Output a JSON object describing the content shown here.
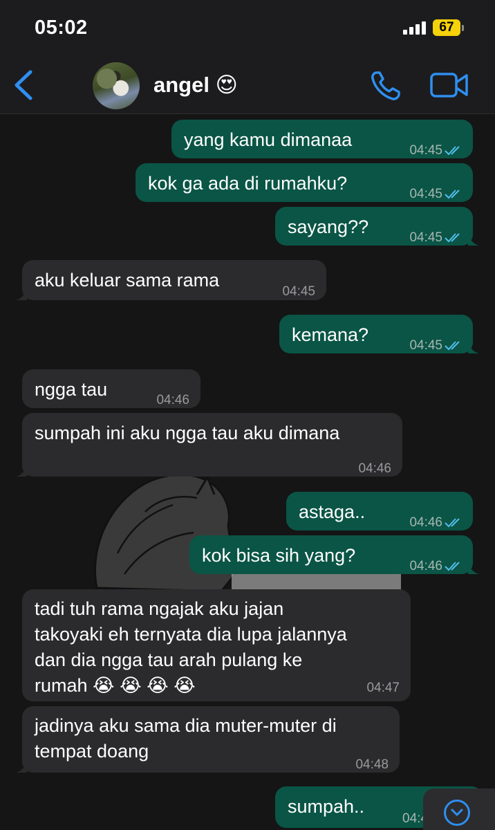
{
  "status_bar": {
    "time": "05:02",
    "battery": "67"
  },
  "header": {
    "contact_name": "angel 😍"
  },
  "messages": [
    {
      "text": "yang kamu dimanaa",
      "time": "04:45"
    },
    {
      "text": "kok ga ada di rumahku?",
      "time": "04:45"
    },
    {
      "text": "sayang??",
      "time": "04:45"
    },
    {
      "text": "aku keluar sama rama",
      "time": "04:45"
    },
    {
      "text": "kemana?",
      "time": "04:45"
    },
    {
      "text": "ngga tau",
      "time": "04:46"
    },
    {
      "text": "sumpah ini aku ngga tau aku dimana",
      "time": "04:46"
    },
    {
      "text": "astaga..",
      "time": "04:46"
    },
    {
      "text": "kok bisa sih yang?",
      "time": "04:46"
    },
    {
      "text": "tadi tuh rama ngajak aku jajan\ntakoyaki eh ternyata dia lupa jalannya\ndan dia ngga tau arah pulang ke\nrumah 😭 😭 😭 😭",
      "time": "04:47"
    },
    {
      "text": "jadinya aku sama dia muter-muter di\ntempat doang",
      "time": "04:48"
    },
    {
      "text": "sumpah..",
      "time": "04:4"
    }
  ],
  "colors": {
    "outgoing": "#0a5546",
    "incoming": "#2b2b2d",
    "accent": "#2f8ff0",
    "read_tick": "#53bdeb"
  },
  "icons": [
    "chevron-left-icon",
    "phone-icon",
    "video-camera-icon",
    "double-check-icon",
    "chevron-down-icon"
  ]
}
